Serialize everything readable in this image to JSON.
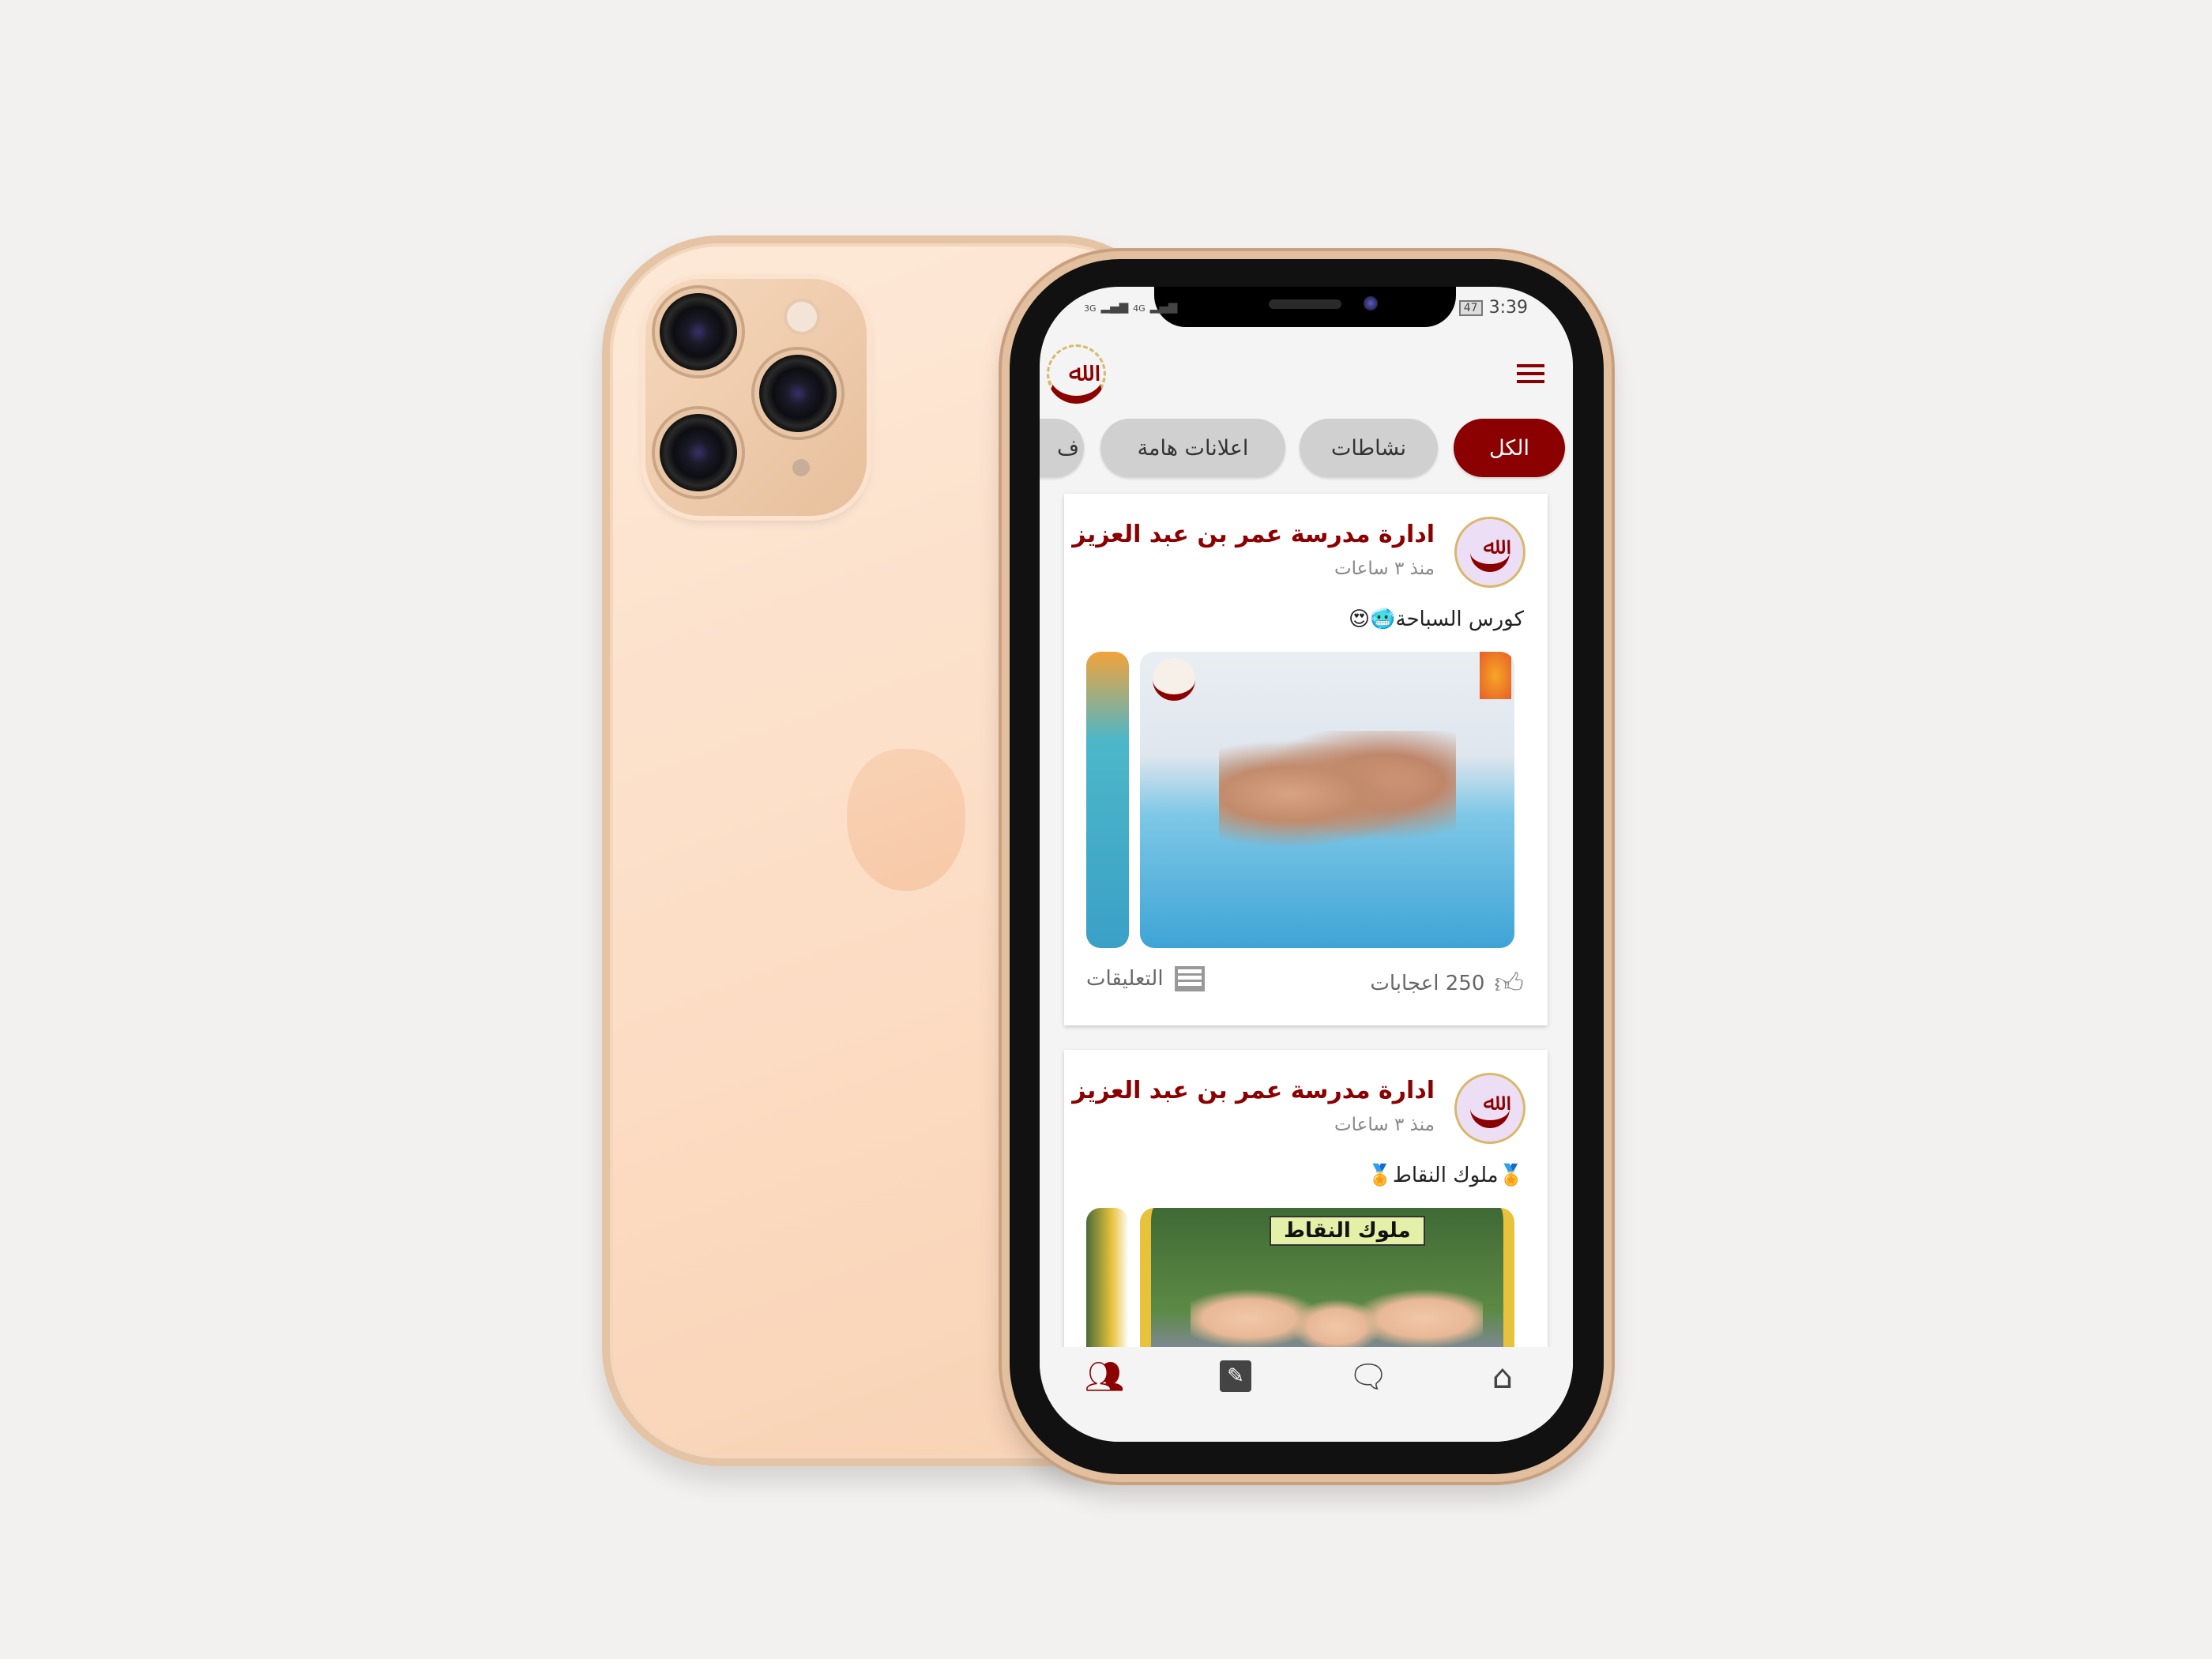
{
  "status_bar": {
    "signal_1": "3G",
    "signal_2": "4G",
    "battery": "47",
    "time": "3:39"
  },
  "header": {
    "logo": "Omar Bin Abd Al-Aziz school logo",
    "menu_icon": "hamburger-icon"
  },
  "tabs": [
    {
      "label": "الكل",
      "active": true
    },
    {
      "label": "نشاطات",
      "active": false
    },
    {
      "label": "اعلانات هامة",
      "active": false
    },
    {
      "label": "ف",
      "active": false
    }
  ],
  "posts": [
    {
      "author": "ادارة مدرسة عمر بن عبد العزيز",
      "time": "منذ ٣ ساعات",
      "caption": "كورس السباحة🥶😍",
      "likes": "250 اعجابات",
      "comments": "التعليقات"
    },
    {
      "author": "ادارة مدرسة عمر بن عبد العزيز",
      "time": "منذ ٣ ساعات",
      "caption": "🏅ملوك النقاط🏅",
      "image_banner": "ملوك النقاط"
    }
  ],
  "bottom_nav": [
    {
      "icon": "users-icon",
      "active": true
    },
    {
      "icon": "edit-icon",
      "active": false
    },
    {
      "icon": "chat-icon",
      "active": false
    },
    {
      "icon": "home-icon",
      "active": false
    }
  ],
  "colors": {
    "brand": "#8b0000",
    "tab_inactive": "#d0d0d0",
    "background": "#f4f4f4"
  }
}
